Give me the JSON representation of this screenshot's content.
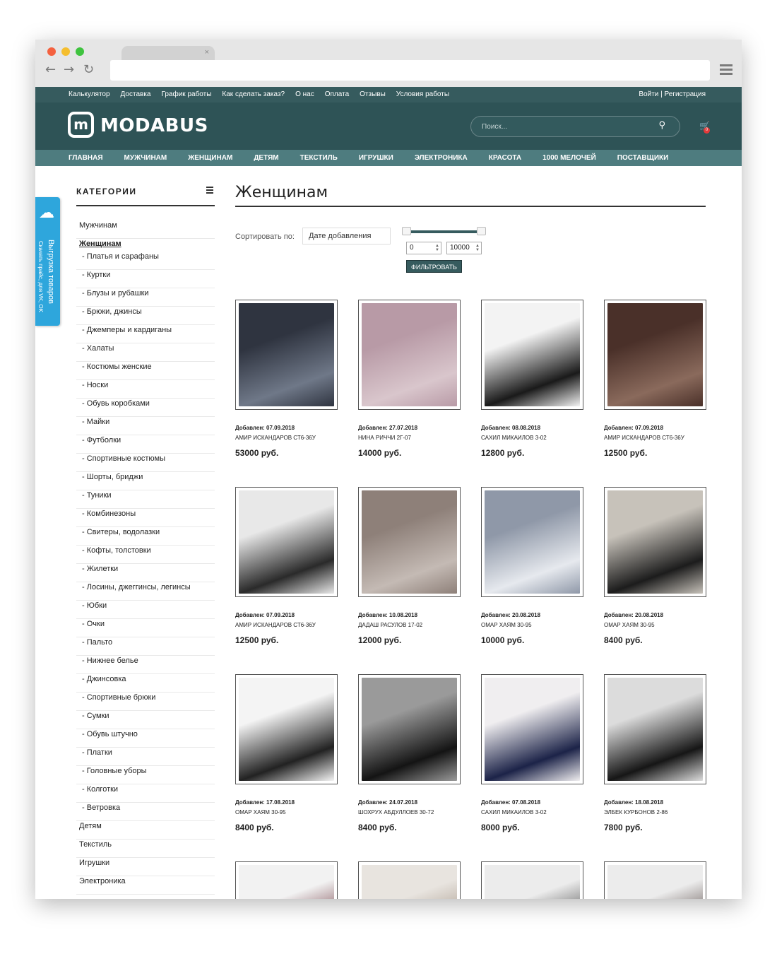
{
  "toplinks": [
    "Калькулятор",
    "Доставка",
    "График работы",
    "Как сделать заказ?",
    "О нас",
    "Оплата",
    "Отзывы",
    "Условия работы"
  ],
  "login_text": "Войти | Регистрация",
  "logo": {
    "mark": "m",
    "name": "MODABUS"
  },
  "search_placeholder": "Поиск...",
  "cart_count": "0",
  "mainnav": [
    "ГЛАВНАЯ",
    "МУЖЧИНАМ",
    "ЖЕНЩИНАМ",
    "ДЕТЯМ",
    "ТЕКСТИЛЬ",
    "ИГРУШКИ",
    "ЭЛЕКТРОНИКА",
    "КРАСОТА",
    "1000 МЕЛОЧЕЙ",
    "ПОСТАВЩИКИ"
  ],
  "sidetab": {
    "line1": "Выгрузка товаров",
    "line2": "Скачать прайс, для VK, OK"
  },
  "sidebar_title": "КАТЕГОРИИ",
  "categories_before": [
    "Мужчинам"
  ],
  "active_category": "Женщинам",
  "subcategories": [
    "Платья и сарафаны",
    "Куртки",
    "Блузы и рубашки",
    "Брюки, джинсы",
    "Джемперы и кардиганы",
    "Халаты",
    "Костюмы женские",
    "Носки",
    "Обувь коробками",
    "Майки",
    "Футболки",
    "Спортивные костюмы",
    "Шорты, бриджи",
    "Туники",
    "Комбинезоны",
    "Свитеры, водолазки",
    "Кофты, толстовки",
    "Жилетки",
    "Лосины, джеггинсы, легинсы",
    "Юбки",
    "Очки",
    "Пальто",
    "Нижнее белье",
    "Джинсовка",
    "Спортивные брюки",
    "Сумки",
    "Обувь штучно",
    "Платки",
    "Головные уборы",
    "Колготки",
    "Ветровка"
  ],
  "categories_after": [
    "Детям",
    "Текстиль",
    "Игрушки",
    "Электроника"
  ],
  "page_title": "Женщинам",
  "sort": {
    "label": "Сортировать по:",
    "value": "Дате добавления"
  },
  "price_filter": {
    "min": "0",
    "max": "10000",
    "button": "ФИЛЬТРОВАТЬ"
  },
  "products": [
    {
      "added": "Добавлен: 07.09.2018",
      "seller": "АМИР ИСКАНДАРОВ СТ6-36У",
      "price": "53000 руб.",
      "colors": [
        "#2f3440",
        "#6f7888"
      ]
    },
    {
      "added": "Добавлен: 27.07.2018",
      "seller": "НИНА РИЧЧИ 2Г-07",
      "price": "14000 руб.",
      "colors": [
        "#b89aa6",
        "#d9c6cc"
      ]
    },
    {
      "added": "Добавлен: 08.08.2018",
      "seller": "САХИЛ МИКАИЛОВ 3-02",
      "price": "12800 руб.",
      "colors": [
        "#f3f3f3",
        "#1a1a1a"
      ]
    },
    {
      "added": "Добавлен: 07.09.2018",
      "seller": "АМИР ИСКАНДАРОВ СТ6-36У",
      "price": "12500 руб.",
      "colors": [
        "#4a3029",
        "#8a6a5c"
      ]
    },
    {
      "added": "Добавлен: 07.09.2018",
      "seller": "АМИР ИСКАНДАРОВ СТ6-36У",
      "price": "12500 руб.",
      "colors": [
        "#e8e8e8",
        "#2a2a2a"
      ]
    },
    {
      "added": "Добавлен: 10.08.2018",
      "seller": "ДАДАШ РАСУЛОВ 17-02",
      "price": "12000 руб.",
      "colors": [
        "#8e8079",
        "#c4bab4"
      ]
    },
    {
      "added": "Добавлен: 20.08.2018",
      "seller": "ОМАР ХАЯМ 30-95",
      "price": "10000 руб.",
      "colors": [
        "#8f98a8",
        "#e6e9ee"
      ]
    },
    {
      "added": "Добавлен: 20.08.2018",
      "seller": "ОМАР ХАЯМ 30-95",
      "price": "8400 руб.",
      "colors": [
        "#c7c2ba",
        "#1c1c1c"
      ]
    },
    {
      "added": "Добавлен: 17.08.2018",
      "seller": "ОМАР ХАЯМ 30-95",
      "price": "8400 руб.",
      "colors": [
        "#f4f4f4",
        "#222222"
      ]
    },
    {
      "added": "Добавлен: 24.07.2018",
      "seller": "ШОХРУХ АБДУЛЛОЕВ 30-72",
      "price": "8400 руб.",
      "colors": [
        "#9a9a9a",
        "#141414"
      ]
    },
    {
      "added": "Добавлен: 07.08.2018",
      "seller": "САХИЛ МИКАИЛОВ 3-02",
      "price": "8000 руб.",
      "colors": [
        "#f0eef0",
        "#1c2348"
      ]
    },
    {
      "added": "Добавлен: 18.08.2018",
      "seller": "ЭЛБЕК КУРБОНОВ 2-86",
      "price": "7800 руб.",
      "colors": [
        "#dcdcdc",
        "#161616"
      ]
    },
    {
      "added": "",
      "seller": "",
      "price": "",
      "colors": [
        "#f2f2f2",
        "#5a1a24"
      ]
    },
    {
      "added": "",
      "seller": "",
      "price": "",
      "colors": [
        "#e8e4df",
        "#9a8a7a"
      ]
    },
    {
      "added": "",
      "seller": "",
      "price": "",
      "colors": [
        "#ececec",
        "#2b2b2b"
      ]
    },
    {
      "added": "",
      "seller": "",
      "price": "",
      "colors": [
        "#ececec",
        "#3a2a26"
      ]
    }
  ]
}
